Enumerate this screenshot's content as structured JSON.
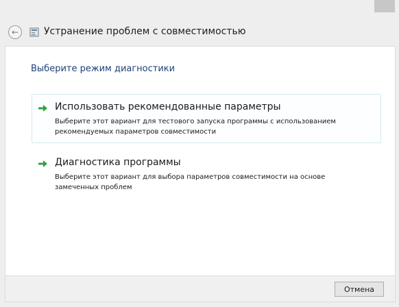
{
  "window": {
    "title": "Устранение проблем с совместимостью"
  },
  "main": {
    "heading": "Выберите режим диагностики",
    "options": [
      {
        "title": "Использовать рекомендованные параметры",
        "description": "Выберите этот вариант для тестового запуска программы с использованием рекомендуемых параметров совместимости"
      },
      {
        "title": "Диагностика программы",
        "description": "Выберите этот вариант для выбора параметров совместимости на основе замеченных проблем"
      }
    ]
  },
  "footer": {
    "cancel_label": "Отмена"
  },
  "icons": {
    "back": "back-arrow-icon",
    "app": "troubleshooter-icon",
    "option_arrow": "green-arrow-icon"
  },
  "colors": {
    "heading": "#1c3f7a",
    "arrow_green": "#2fa33c",
    "option_hover_border": "#d4e8ee"
  }
}
